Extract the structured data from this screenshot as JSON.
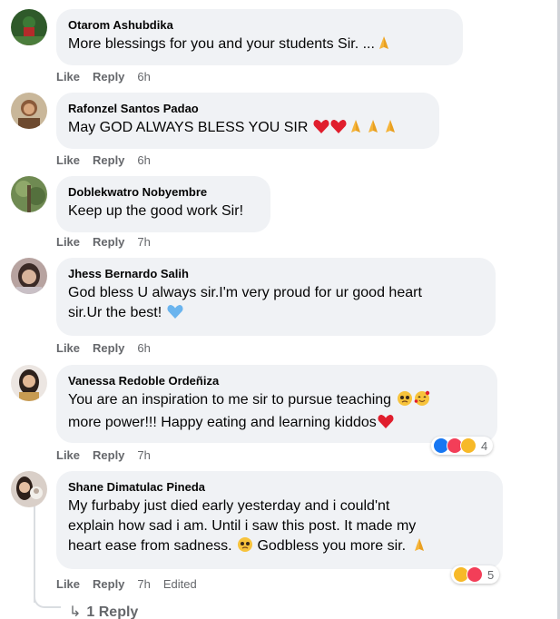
{
  "comments": [
    {
      "author": "Otarom Ashubdika",
      "text": "More blessings for you and your students Sir. ...",
      "emojis": [
        "folded-hands-emoji"
      ],
      "like": "Like",
      "reply": "Reply",
      "time": "6h",
      "edited": ""
    },
    {
      "author": "Rafonzel Santos Padao",
      "text": "May GOD ALWAYS BLESS YOU SIR",
      "emojis": [
        "red-heart-emoji",
        "red-heart-emoji",
        "folded-hands-emoji",
        "folded-hands-emoji",
        "folded-hands-emoji"
      ],
      "like": "Like",
      "reply": "Reply",
      "time": "6h",
      "edited": ""
    },
    {
      "author": "Doblekwatro Nobyembre",
      "text": "Keep up the good work Sir!",
      "like": "Like",
      "reply": "Reply",
      "time": "7h",
      "edited": ""
    },
    {
      "author": "Jhess Bernardo Salih",
      "text_line1": "God bless U always sir.I'm very proud for ur good heart",
      "text_line2": "sir.Ur the best!",
      "emojis": [
        "blue-heart-emoji"
      ],
      "like": "Like",
      "reply": "Reply",
      "time": "6h",
      "edited": ""
    },
    {
      "author": "Vanessa Redoble Ordeñiza",
      "text_line1": "You are an inspiration to me sir to pursue teaching",
      "text_line2": "more power!!! Happy eating and learning kiddos",
      "emojis": [
        "pleading-face-emoji",
        "smiling-face-with-hearts-emoji",
        "red-heart-emoji"
      ],
      "like": "Like",
      "reply": "Reply",
      "time": "7h",
      "edited": "",
      "reactions": [
        "like-reaction",
        "love-reaction",
        "care-reaction"
      ],
      "reaction_count": "4"
    },
    {
      "author": "Shane Dimatulac Pineda",
      "text_line1": "My furbaby just died early yesterday and i could'nt",
      "text_line2": "explain how sad i am. Until i saw this post. It made my",
      "text_line3": "heart ease from sadness.",
      "text_line3b": "Godbless you more sir.",
      "emojis": [
        "pleading-face-emoji",
        "folded-hands-emoji"
      ],
      "like": "Like",
      "reply": "Reply",
      "time": "7h",
      "edited": "Edited",
      "reactions": [
        "care-reaction",
        "love-reaction"
      ],
      "reaction_count": "5"
    }
  ],
  "replies_link": {
    "arrow": "↳",
    "label": "1 Reply"
  },
  "colors": {
    "bubble_bg": "#f0f2f5",
    "meta_text": "#65676b",
    "like_blue": "#1877f2",
    "love_red": "#f33e58",
    "care_yellow": "#f7b928"
  }
}
